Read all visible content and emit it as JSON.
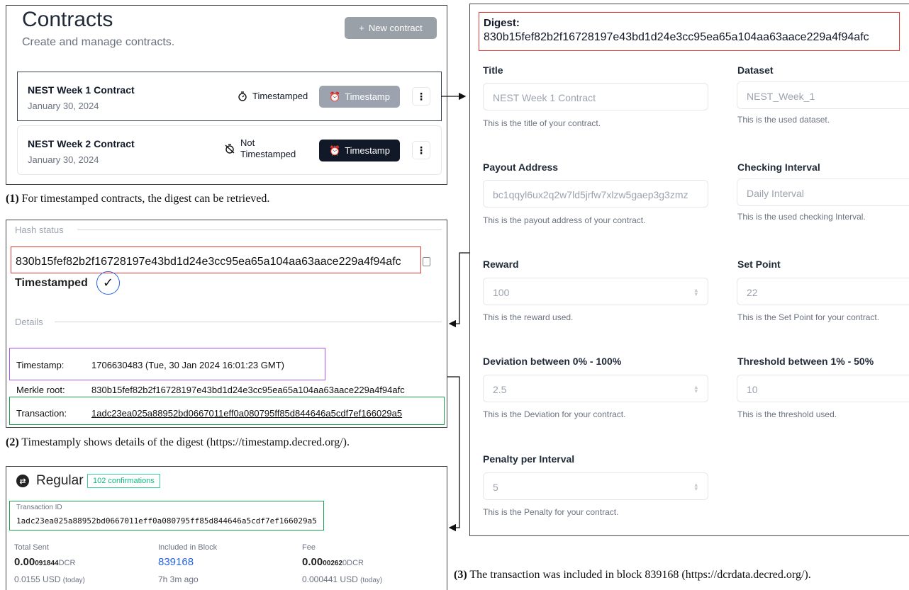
{
  "panel1": {
    "title": "Contracts",
    "subtitle": "Create and manage contracts.",
    "new_button": "New contract",
    "contracts": [
      {
        "name": "NEST Week 1 Contract",
        "date": "January 30, 2024",
        "status": "Timestamped",
        "button": "Timestamp",
        "kebab": "⋮"
      },
      {
        "name": "NEST Week 2 Contract",
        "date": "January 30, 2024",
        "status_line1": "Not",
        "status_line2": "Timestamped",
        "button": "Timestamp",
        "kebab": "⋮"
      }
    ]
  },
  "caption1": {
    "num": "(1)",
    "text": " For timestamped contracts, the digest can be retrieved."
  },
  "panel2": {
    "hash_section": "Hash status",
    "hash": "830b15fef82b2f16728197e43bd1d24e3cc95ea65a104aa63aace229a4f94afc",
    "status": "Timestamped",
    "details_section": "Details",
    "rows": [
      {
        "key": "Timestamp:",
        "value": "1706630483 (Tue, 30 Jan 2024 16:01:23 GMT)"
      },
      {
        "key": "Merkle root:",
        "value": "830b15fef82b2f16728197e43bd1d24e3cc95ea65a104aa63aace229a4f94afc"
      },
      {
        "key": "Transaction:",
        "value": "1adc23ea025a88952bd0667011eff0a080795ff85d844646a5cdf7ef166029a5"
      }
    ]
  },
  "caption2": {
    "num": "(2)",
    "text": " Timestamply shows details of the digest (https://timestamp.decred.org/)."
  },
  "panel3": {
    "type": "Regular",
    "confirmations": "102 confirmations",
    "txid_label": "Transaction ID",
    "txid": "1adc23ea025a88952bd0667011eff0a080795ff85d844646a5cdf7ef166029a5",
    "total_sent": {
      "label": "Total Sent",
      "big": "0.00",
      "small": "091844",
      "unit": "DCR",
      "usd": "0.0155",
      "usd_unit": "USD",
      "today": "(today)"
    },
    "block": {
      "label": "Included in Block",
      "value": "839168",
      "ago": "7h 3m ago"
    },
    "fee": {
      "label": "Fee",
      "big": "0.00",
      "small": "00262",
      "dim": "0",
      "unit": "DCR",
      "usd": "0.000441",
      "usd_unit": "USD",
      "today": "(today)"
    }
  },
  "caption3": {
    "num": "(3)",
    "text": " The transaction was included in block 839168 (https://dcrdata.decred.org/)."
  },
  "panel4": {
    "digest_label": "Digest:",
    "digest": "830b15fef82b2f16728197e43bd1d24e3cc95ea65a104aa63aace229a4f94afc",
    "fields": {
      "title": {
        "label": "Title",
        "value": "NEST Week 1 Contract",
        "help": "This is the title of your contract."
      },
      "dataset": {
        "label": "Dataset",
        "value": "NEST_Week_1",
        "help": "This is the used dataset."
      },
      "payout": {
        "label": "Payout Address",
        "value": "bc1qqyl6ux2q2w7ld5jrfw7xlzw5gaep3g3zmz",
        "help": "This is the payout address of your contract."
      },
      "interval": {
        "label": "Checking Interval",
        "value": "Daily Interval",
        "help": "This is the used checking Interval."
      },
      "reward": {
        "label": "Reward",
        "value": "100",
        "help": "This is the reward used."
      },
      "setpoint": {
        "label": "Set Point",
        "value": "22",
        "help": "This is the Set Point for your contract."
      },
      "deviation": {
        "label": "Deviation between 0% - 100%",
        "value": "2.5",
        "help": "This is the Deviation for your contract."
      },
      "threshold": {
        "label": "Threshold between 1% - 50%",
        "value": "10",
        "help": "This is the threshold used."
      },
      "penalty": {
        "label": "Penalty per Interval",
        "value": "5",
        "help": "This is the Penalty for your contract."
      }
    }
  }
}
